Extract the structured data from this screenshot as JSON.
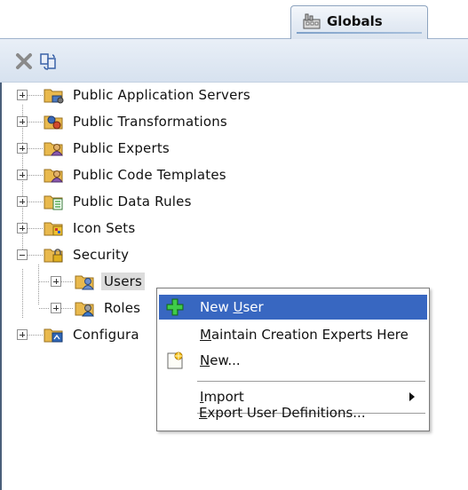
{
  "tab": {
    "label": "Globals",
    "icon": "factory-icon"
  },
  "toolbar": {
    "buttons": [
      {
        "name": "delete-button",
        "icon": "x-icon"
      },
      {
        "name": "refresh-button",
        "icon": "refresh-icon"
      }
    ]
  },
  "tree": {
    "items": [
      {
        "label": "Public Application Servers",
        "icon": "folder-server-icon",
        "expander": "plus"
      },
      {
        "label": "Public Transformations",
        "icon": "folder-transform-icon",
        "expander": "plus"
      },
      {
        "label": "Public Experts",
        "icon": "folder-expert-icon",
        "expander": "plus"
      },
      {
        "label": "Public Code Templates",
        "icon": "folder-template-icon",
        "expander": "plus"
      },
      {
        "label": "Public Data Rules",
        "icon": "folder-rules-icon",
        "expander": "plus"
      },
      {
        "label": "Icon Sets",
        "icon": "folder-iconset-icon",
        "expander": "plus"
      },
      {
        "label": "Security",
        "icon": "folder-lock-icon",
        "expander": "minus",
        "children": [
          {
            "label": "Users",
            "icon": "folder-users-icon",
            "expander": "plus",
            "selected": true
          },
          {
            "label": "Roles",
            "icon": "folder-roles-icon",
            "expander": "plus"
          }
        ]
      },
      {
        "label": "Configura",
        "icon": "folder-config-icon",
        "expander": "plus"
      }
    ]
  },
  "context_menu": {
    "items": [
      {
        "pre": "New ",
        "mnemonic": "U",
        "post": "ser",
        "icon": "plus-icon",
        "active": true
      },
      {
        "pre": "",
        "mnemonic": "M",
        "post": "aintain Creation Experts Here"
      },
      {
        "pre": "",
        "mnemonic": "N",
        "post": "ew...",
        "icon": "new-icon"
      },
      {
        "pre": "",
        "mnemonic": "I",
        "post": "mport",
        "submenu": true
      },
      {
        "pre": "",
        "mnemonic": "E",
        "post": "xport User Definitions..."
      }
    ]
  },
  "colors": {
    "menu_highlight": "#3867c1",
    "toolbar_bg": "#dfe7f1",
    "selection_bg": "#dcdcdc"
  }
}
